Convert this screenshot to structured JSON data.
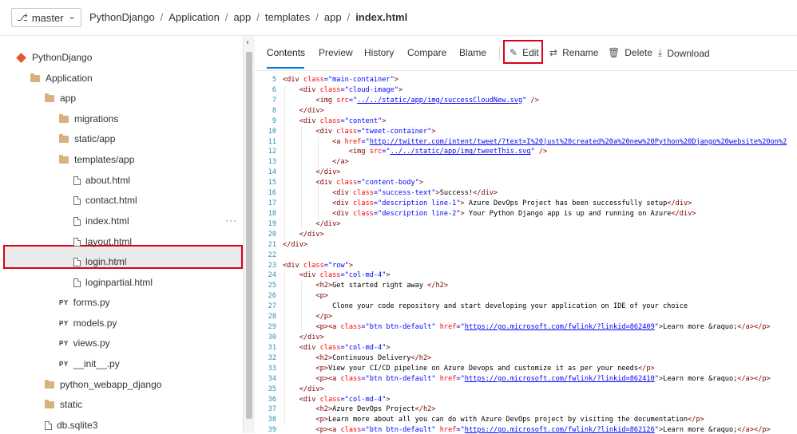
{
  "branch": {
    "name": "master"
  },
  "breadcrumb": [
    "PythonDjango",
    "Application",
    "app",
    "templates",
    "app"
  ],
  "breadcrumb_current": "index.html",
  "tree": {
    "repo": "PythonDjango",
    "application": "Application",
    "app": "app",
    "migrations": "migrations",
    "static_app": "static/app",
    "templates_app": "templates/app",
    "about": "about.html",
    "contact": "contact.html",
    "index": "index.html",
    "layout": "layout.html",
    "login": "login.html",
    "loginpartial": "loginpartial.html",
    "forms": "forms.py",
    "models": "models.py",
    "views": "views.py",
    "init": "__init__.py",
    "python_webapp": "python_webapp_django",
    "static": "static",
    "db": "db.sqlite3",
    "py_badge": "PY",
    "more": "···"
  },
  "tabs": [
    "Contents",
    "Preview",
    "History",
    "Compare",
    "Blame"
  ],
  "actions": {
    "edit": "Edit",
    "rename": "Rename",
    "delete": "Delete",
    "download": "Download"
  },
  "code": [
    {
      "n": "5",
      "t": "<div class=\"main-container\">"
    },
    {
      "n": "6",
      "t": "    <div class=\"cloud-image\">"
    },
    {
      "n": "7",
      "t": "        <img src=\"../../static/app/img/successCloudNew.svg\" />"
    },
    {
      "n": "8",
      "t": "    </div>"
    },
    {
      "n": "9",
      "t": "    <div class=\"content\">"
    },
    {
      "n": "10",
      "t": "        <div class=\"tweet-container\">"
    },
    {
      "n": "11",
      "t": "            <a href=\"http://twitter.com/intent/tweet/?text=I%20just%20created%20a%20new%20Python%20Django%20website%20on%2"
    },
    {
      "n": "12",
      "t": "                <img src=\"../../static/app/img/tweetThis.svg\" />"
    },
    {
      "n": "13",
      "t": "            </a>"
    },
    {
      "n": "14",
      "t": "        </div>"
    },
    {
      "n": "15",
      "t": "        <div class=\"content-body\">"
    },
    {
      "n": "16",
      "t": "            <div class=\"success-text\">Success!</div>"
    },
    {
      "n": "17",
      "t": "            <div class=\"description line-1\"> Azure DevOps Project has been successfully setup</div>"
    },
    {
      "n": "18",
      "t": "            <div class=\"description line-2\"> Your Python Django app is up and running on Azure</div>"
    },
    {
      "n": "19",
      "t": "        </div>"
    },
    {
      "n": "20",
      "t": "    </div>"
    },
    {
      "n": "21",
      "t": "</div>"
    },
    {
      "n": "22",
      "t": ""
    },
    {
      "n": "23",
      "t": "<div class=\"row\">"
    },
    {
      "n": "24",
      "t": "    <div class=\"col-md-4\">"
    },
    {
      "n": "25",
      "t": "        <h2>Get started right away </h2>"
    },
    {
      "n": "26",
      "t": "        <p>"
    },
    {
      "n": "27",
      "t": "            Clone your code repository and start developing your application on IDE of your choice"
    },
    {
      "n": "28",
      "t": "        </p>"
    },
    {
      "n": "29",
      "t": "        <p><a class=\"btn btn-default\" href=\"https://go.microsoft.com/fwlink/?linkid=862409\">Learn more &raquo;</a></p>"
    },
    {
      "n": "30",
      "t": "    </div>"
    },
    {
      "n": "31",
      "t": "    <div class=\"col-md-4\">"
    },
    {
      "n": "32",
      "t": "        <h2>Continuous Delivery</h2>"
    },
    {
      "n": "33",
      "t": "        <p>View your CI/CD pipeline on Azure Devops and customize it as per your needs</p>"
    },
    {
      "n": "34",
      "t": "        <p><a class=\"btn btn-default\" href=\"https://go.microsoft.com/fwlink/?linkid=862410\">Learn more &raquo;</a></p>"
    },
    {
      "n": "35",
      "t": "    </div>"
    },
    {
      "n": "36",
      "t": "    <div class=\"col-md-4\">"
    },
    {
      "n": "37",
      "t": "        <h2>Azure DevOps Project</h2>"
    },
    {
      "n": "38",
      "t": "        <p>Learn more about all you can do with Azure DevOps project by visiting the documentation</p>"
    },
    {
      "n": "39",
      "t": "        <p><a class=\"btn btn-default\" href=\"https://go.microsoft.com/fwlink/?linkid=862126\">Learn more &raquo;</a></p>"
    }
  ],
  "colors": {
    "accent": "#0078d4",
    "highlight": "#d9021a",
    "tag": "#800000",
    "attr": "#ff0000",
    "value": "#0000ff",
    "linenum": "#2b91af"
  }
}
